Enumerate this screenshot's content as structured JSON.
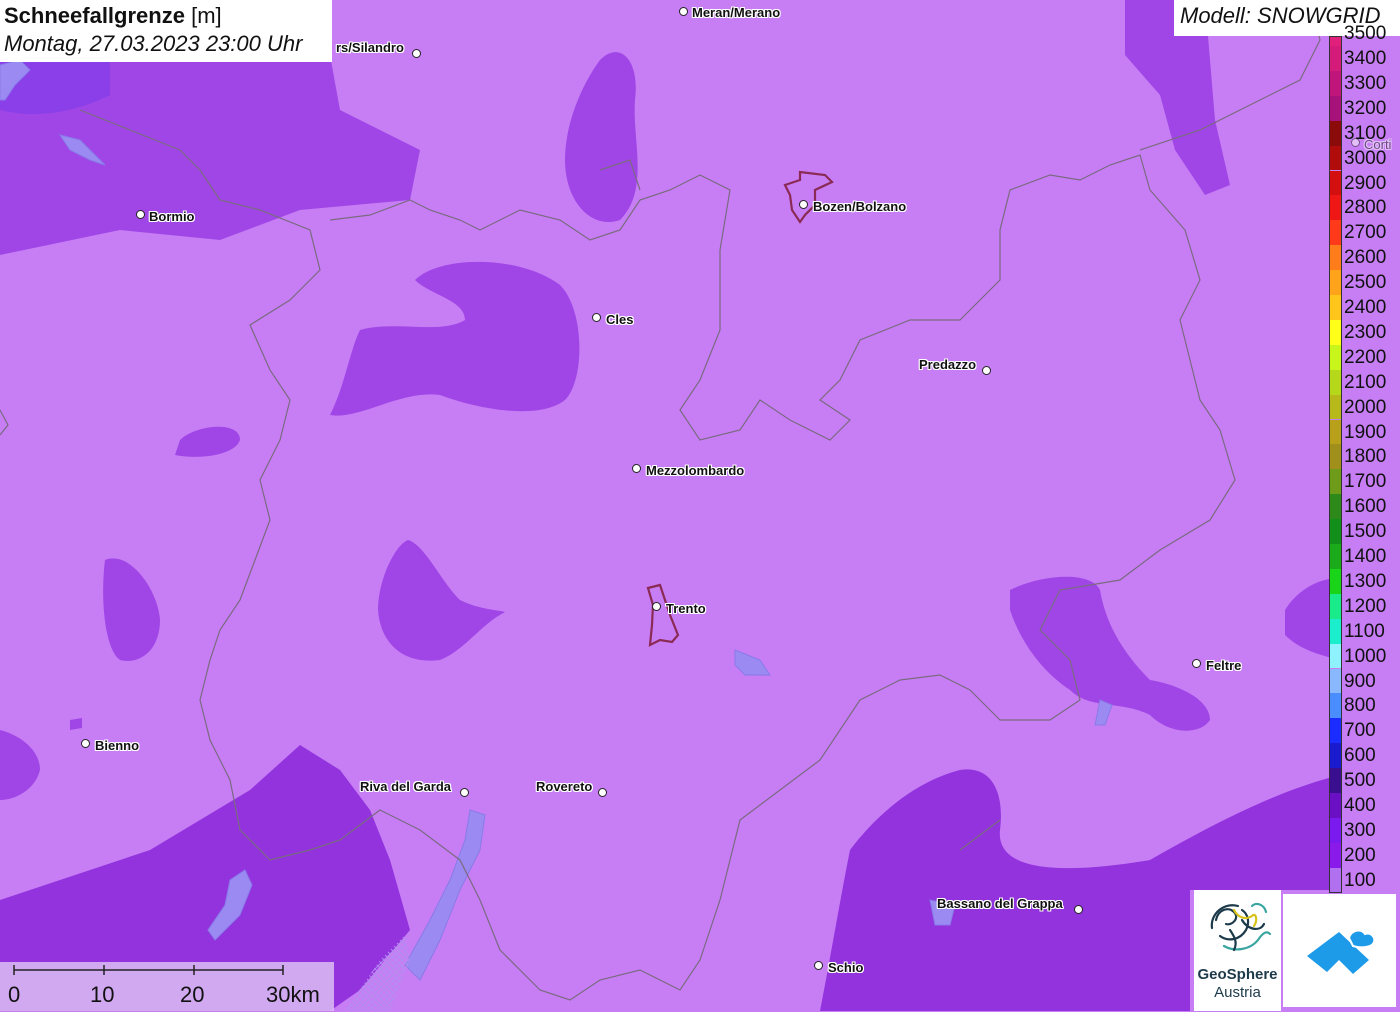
{
  "title": {
    "parameter": "Schneefallgrenze",
    "unit": "[m]",
    "datetime": "Montag, 27.03.2023 23:00 Uhr"
  },
  "model": "Modell: SNOWGRID",
  "legend": {
    "top_partial": "3500",
    "labels": [
      "3400",
      "3300",
      "3200",
      "3100",
      "3000",
      "2900",
      "2800",
      "2700",
      "2600",
      "2500",
      "2400",
      "2300",
      "2200",
      "2100",
      "2000",
      "1900",
      "1800",
      "1700",
      "1600",
      "1500",
      "1400",
      "1300",
      "1200",
      "1100",
      "1000",
      "900",
      "800",
      "700",
      "600",
      "500",
      "400",
      "300",
      "200",
      "100"
    ],
    "colors": [
      "#d41b79",
      "#c0157a",
      "#a6127a",
      "#8b0a0a",
      "#b00c0c",
      "#d40f0f",
      "#ef1616",
      "#ff3a1a",
      "#ff7c1a",
      "#ffa31a",
      "#ffc51a",
      "#ffff1a",
      "#c8f51a",
      "#b5d81a",
      "#b7b81a",
      "#b9a01a",
      "#a08f1a",
      "#6f9b1a",
      "#2d8a1a",
      "#118f1a",
      "#1aaa1a",
      "#1ad41a",
      "#1aeb8a",
      "#1aeecc",
      "#8ff2ff",
      "#8ab8ff",
      "#4a8dff",
      "#1a2cff",
      "#1a1acf",
      "#3a0f8f",
      "#6a0fc4",
      "#7a1aef",
      "#8a1aea",
      "#b070f0"
    ]
  },
  "cities": [
    {
      "name": "Meran/Merano"
    },
    {
      "name": "rs/Silandro"
    },
    {
      "name": "Bozen/Bolzano"
    },
    {
      "name": "Bormio"
    },
    {
      "name": "Cles"
    },
    {
      "name": "Predazzo"
    },
    {
      "name": "Mezzolombardo"
    },
    {
      "name": "Trento"
    },
    {
      "name": "Feltre"
    },
    {
      "name": "Bienno"
    },
    {
      "name": "Riva del Garda"
    },
    {
      "name": "Rovereto"
    },
    {
      "name": "Bassano del Grappa"
    },
    {
      "name": "Schio"
    },
    {
      "name": "Corti"
    }
  ],
  "scale": {
    "labels": [
      "0",
      "10",
      "20",
      "30km"
    ]
  },
  "logo": {
    "name": "GeoSphere",
    "sub": "Austria"
  },
  "colors": {
    "base_region": "#c77ef5",
    "dark_region": "#9a3fe0",
    "deep_region": "#8a2fd8",
    "border_line": "#7a6a80",
    "city_outline": "#8a2a55",
    "logo_blue": "#1e9be8"
  }
}
